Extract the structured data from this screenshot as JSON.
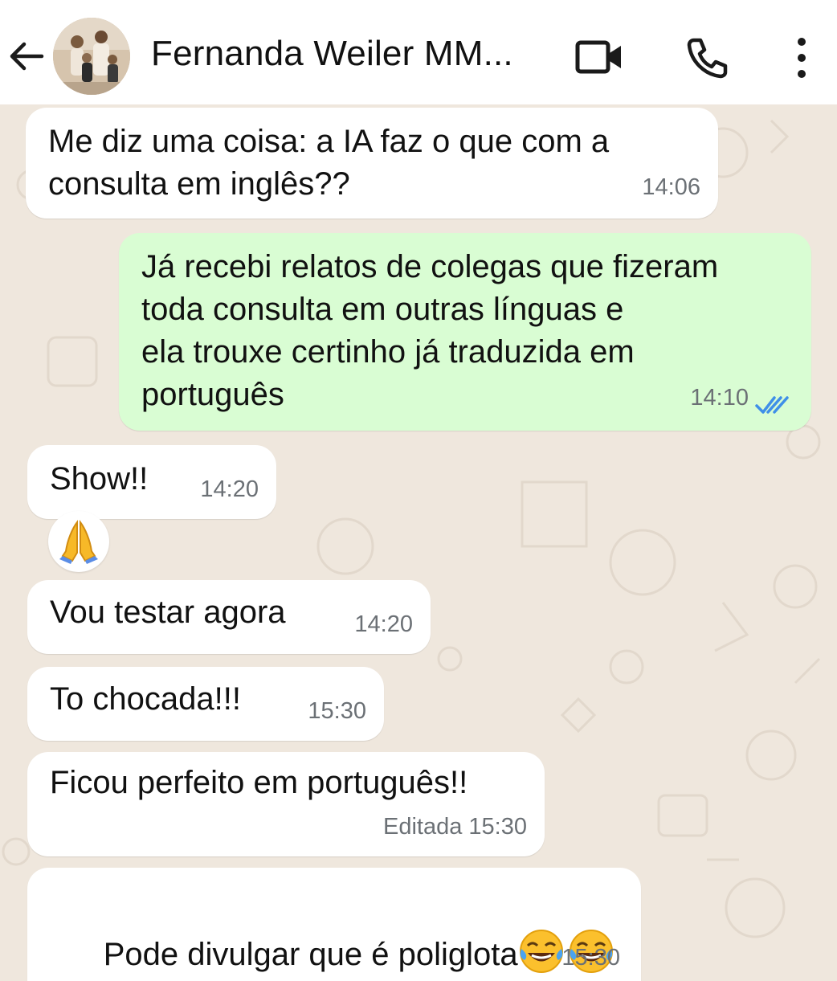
{
  "header": {
    "contact_name": "Fernanda Weiler MM...",
    "icons": [
      "back-arrow-icon",
      "avatar",
      "video-call-icon",
      "phone-icon",
      "more-vert-icon"
    ]
  },
  "colors": {
    "chat_background": "#efe7dd",
    "incoming_bubble": "#ffffff",
    "outgoing_bubble": "#d9fdd3",
    "read_ticks": "#3f8fe8"
  },
  "messages": [
    {
      "direction": "incoming",
      "text": "Me diz uma coisa: a IA faz o que com a\nconsulta em inglês??",
      "time": "14:06"
    },
    {
      "direction": "outgoing",
      "text": "Já recebi relatos de colegas que fizeram\ntoda consulta em outras línguas e\nela trouxe certinho já traduzida em\nportuguês",
      "time": "14:10",
      "status": "read"
    },
    {
      "direction": "incoming",
      "text": "Show!!",
      "time": "14:20",
      "reaction": "🙏"
    },
    {
      "direction": "incoming",
      "text": "Vou testar agora",
      "time": "14:20"
    },
    {
      "direction": "incoming",
      "text": "To chocada!!!",
      "time": "15:30"
    },
    {
      "direction": "incoming",
      "text": "Ficou perfeito em português!!",
      "time": "Editada 15:30"
    },
    {
      "direction": "incoming",
      "text": "Pode divulgar que é poliglota",
      "emoji": [
        "😂",
        "😂"
      ],
      "time": "15:30"
    }
  ]
}
